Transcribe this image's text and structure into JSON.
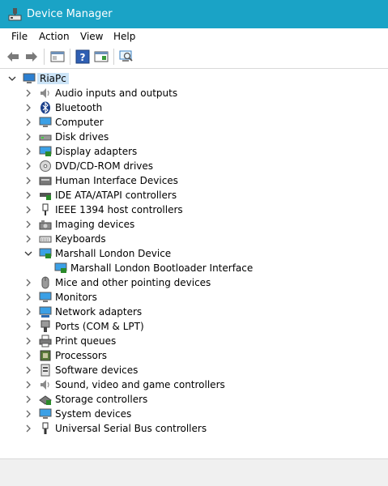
{
  "window": {
    "title": "Device Manager"
  },
  "menu": {
    "file": "File",
    "action": "Action",
    "view": "View",
    "help": "Help"
  },
  "tree": {
    "root": "RiaPc",
    "categories": [
      "Audio inputs and outputs",
      "Bluetooth",
      "Computer",
      "Disk drives",
      "Display adapters",
      "DVD/CD-ROM drives",
      "Human Interface Devices",
      "IDE ATA/ATAPI controllers",
      "IEEE 1394 host controllers",
      "Imaging devices",
      "Keyboards",
      "Marshall London Device",
      "Marshall London Bootloader Interface",
      "Mice and other pointing devices",
      "Monitors",
      "Network adapters",
      "Ports (COM & LPT)",
      "Print queues",
      "Processors",
      "Software devices",
      "Sound, video and game controllers",
      "Storage controllers",
      "System devices",
      "Universal Serial Bus controllers"
    ]
  },
  "colors": {
    "titlebar": "#1aa3c6",
    "selection": "#cce4f7"
  }
}
